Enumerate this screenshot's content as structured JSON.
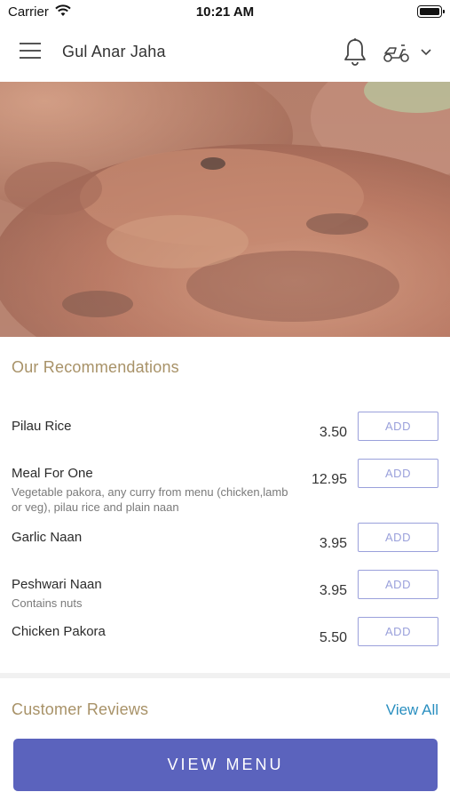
{
  "status_bar": {
    "carrier": "Carrier",
    "time": "10:21 AM"
  },
  "header": {
    "title": "Gul Anar Jaha"
  },
  "recommendations": {
    "title": "Our Recommendations",
    "items": [
      {
        "name": "Pilau Rice",
        "description": "",
        "price": "3.50",
        "add_label": "ADD"
      },
      {
        "name": "Meal For One",
        "description": "Vegetable pakora, any curry from menu (chicken,lamb or veg), pilau rice and plain naan",
        "price": "12.95",
        "add_label": "ADD"
      },
      {
        "name": "Garlic Naan",
        "description": "",
        "price": "3.95",
        "add_label": "ADD"
      },
      {
        "name": "Peshwari Naan",
        "description": "Contains nuts",
        "price": "3.95",
        "add_label": "ADD"
      },
      {
        "name": "Chicken Pakora",
        "description": "",
        "price": "5.50",
        "add_label": "ADD"
      }
    ]
  },
  "reviews": {
    "title": "Customer Reviews",
    "view_all_label": "View All"
  },
  "footer": {
    "view_menu_label": "VIEW MENU"
  },
  "colors": {
    "accent": "#5b63bd",
    "section_title": "#a89268",
    "link": "#2a8fc0",
    "add_border": "#9aa0db"
  }
}
